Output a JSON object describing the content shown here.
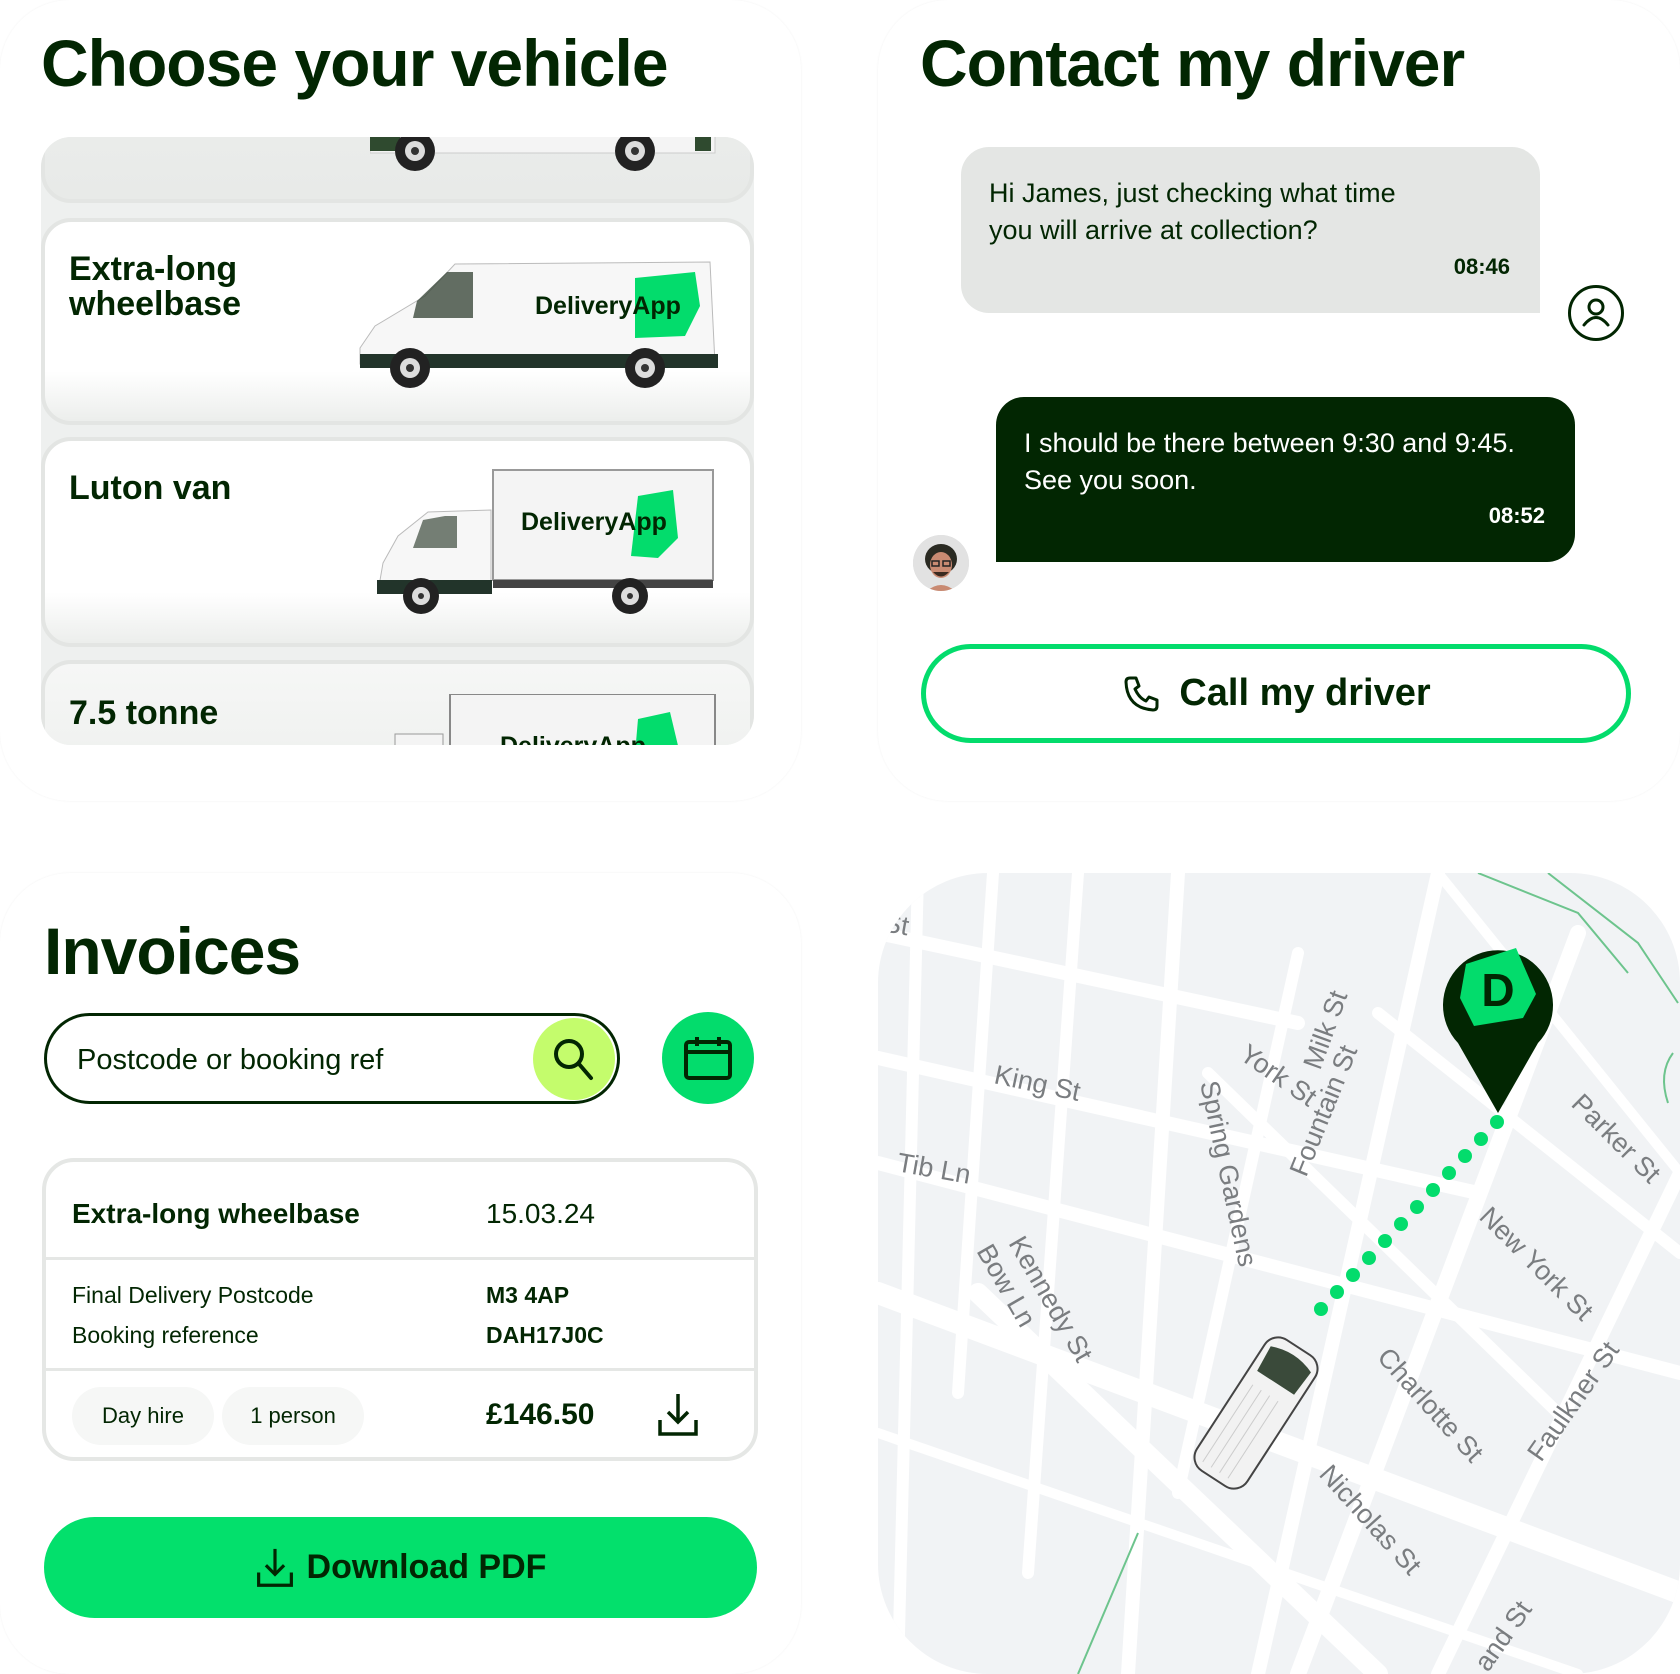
{
  "vehicle_panel": {
    "title": "Choose your vehicle",
    "vehicles": [
      {
        "name": "",
        "brand": ""
      },
      {
        "name": "Extra-long wheelbase",
        "name_line1": "Extra-long",
        "name_line2": "wheelbase",
        "brand": "DeliveryApp"
      },
      {
        "name": "Luton van",
        "brand": "DeliveryApp"
      },
      {
        "name": "7.5 tonne",
        "brand": "DeliveryApp"
      }
    ]
  },
  "chat_panel": {
    "title": "Contact my driver",
    "messages": [
      {
        "sender": "user",
        "text": "Hi James, just checking what time you will arrive at collection?",
        "time": "08:46"
      },
      {
        "sender": "driver",
        "text": "I should be there between 9:30 and 9:45. See you soon.",
        "time": "08:52"
      }
    ],
    "call_button": "Call my driver",
    "icons": {
      "user": "user-circle-icon",
      "call": "phone-icon"
    }
  },
  "invoices_panel": {
    "title": "Invoices",
    "search": {
      "placeholder": "Postcode or booking ref",
      "value": ""
    },
    "invoice": {
      "vehicle": "Extra-long wheelbase",
      "date": "15.03.24",
      "fields": [
        {
          "label": "Final Delivery Postcode",
          "value": "M3 4AP"
        },
        {
          "label": "Booking reference",
          "value": "DAH17J0C"
        }
      ],
      "tags": [
        "Day hire",
        "1 person"
      ],
      "price": "£146.50"
    },
    "download_button": "Download PDF"
  },
  "map_panel": {
    "pin_letter": "D",
    "streets": [
      "King St",
      "Tib Ln",
      "Spring Gardens",
      "York St",
      "Milk St",
      "Fountain St",
      "Parker St",
      "New York St",
      "Kennedy St",
      "Bow Ln",
      "Charlotte St",
      "Faulkner St",
      "Nicholas St",
      "and St",
      "St"
    ]
  },
  "colors": {
    "dark_green": "#022602",
    "brand_green": "#03dc6c",
    "lime": "#c4fc6c",
    "bubble_grey": "#e4e6e4",
    "map_bg": "#f1f3f5"
  }
}
